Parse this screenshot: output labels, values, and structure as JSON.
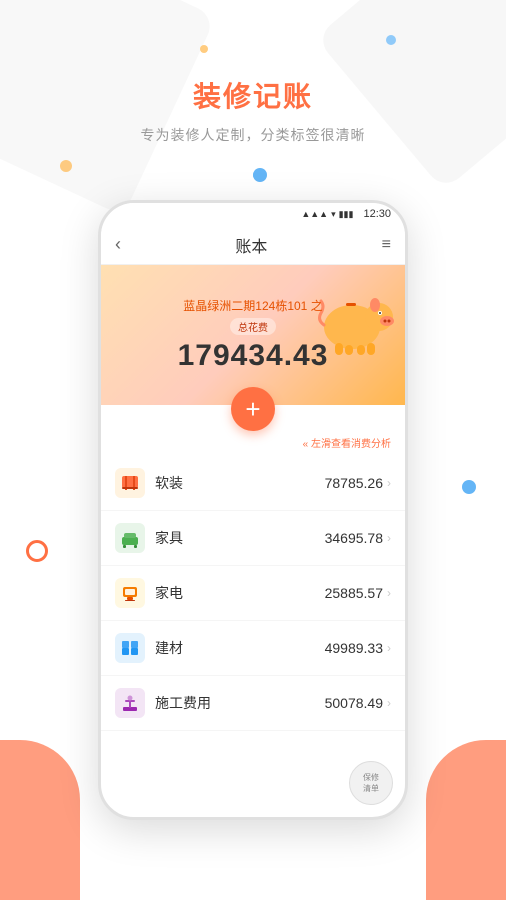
{
  "page": {
    "bg_color": "#f9f9f9"
  },
  "top": {
    "main_title": "装修记账",
    "sub_title": "专为装修人定制，分类标签很清晰"
  },
  "dots": [
    {
      "color": "#90caf9",
      "size": 10
    },
    {
      "color": "#90caf9",
      "size": 10
    },
    {
      "color": "#64b5f6",
      "size": 14
    }
  ],
  "status_bar": {
    "time": "12:30",
    "signal": "▲",
    "wifi": "wifi",
    "battery": "battery"
  },
  "header": {
    "back_label": "‹",
    "title": "账本",
    "menu_label": "≡"
  },
  "banner": {
    "project_name": "蓝晶绿洲二期124栋101 之",
    "total_label": "总花费",
    "total_amount": "179434.43"
  },
  "fab": {
    "label": "+"
  },
  "hint": {
    "text": "« 左滑查看消费分析"
  },
  "categories": [
    {
      "name": "软装",
      "amount": "78785.26",
      "icon_color": "#ff7043",
      "icon_char": "帘",
      "icon_bg": "#fff3e0"
    },
    {
      "name": "家具",
      "amount": "34695.78",
      "icon_color": "#4caf50",
      "icon_char": "床",
      "icon_bg": "#e8f5e9"
    },
    {
      "name": "家电",
      "amount": "25885.57",
      "icon_color": "#f57c00",
      "icon_char": "电",
      "icon_bg": "#fff8e1"
    },
    {
      "name": "建材",
      "amount": "49989.33",
      "icon_color": "#2196f3",
      "icon_char": "材",
      "icon_bg": "#e3f2fd"
    },
    {
      "name": "施工费用",
      "amount": "50078.49",
      "icon_color": "#9c27b0",
      "icon_char": "工",
      "icon_bg": "#f3e5f5"
    }
  ],
  "bottom_btn": {
    "line1": "保修",
    "line2": "清单"
  },
  "decorative": {
    "dot_tl_color": "#ffcc80",
    "dot_tr_color": "#90caf9",
    "dot_side_color": "#64b5f6"
  }
}
